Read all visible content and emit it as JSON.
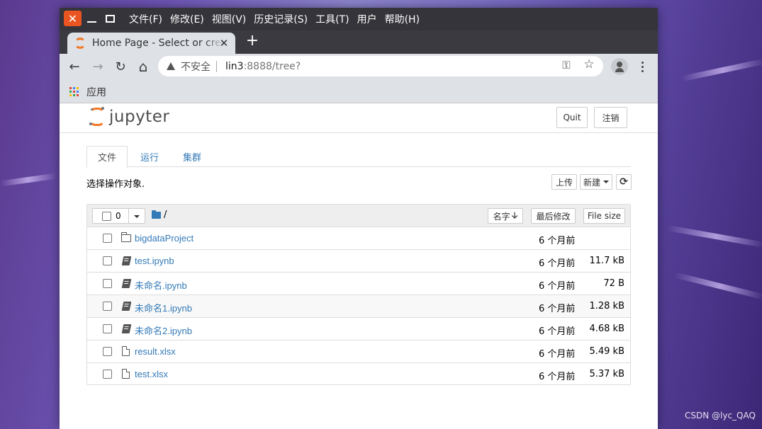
{
  "os": {
    "close_glyph": "✕",
    "watermark": "CSDN @lyc_QAQ"
  },
  "menubar": {
    "items": [
      {
        "label": "文件(F)"
      },
      {
        "label": "修改(E)"
      },
      {
        "label": "视图(V)"
      },
      {
        "label": "历史记录(S)"
      },
      {
        "label": "工具(T)"
      },
      {
        "label": "用户"
      },
      {
        "label": "帮助(H)"
      }
    ]
  },
  "browser": {
    "tab": {
      "title": "Home Page - Select or create a notebook",
      "close": "✕"
    },
    "new_tab": "+",
    "nav": {
      "back": "←",
      "forward": "→",
      "reload": "↻",
      "home": "⌂"
    },
    "omnibox": {
      "security": "不安全",
      "host": "lin3",
      "path": ":8888/tree?",
      "key_icon": "⚿",
      "star_icon": "☆"
    },
    "bookmarks": {
      "apps_label": "应用"
    }
  },
  "jupyter": {
    "logo_text": "jupyter",
    "quit_label": "Quit",
    "logout_label": "注销",
    "tabs": [
      {
        "label": "文件",
        "active": true
      },
      {
        "label": "运行",
        "active": false
      },
      {
        "label": "集群",
        "active": false
      }
    ],
    "select_label": "选择操作对象.",
    "upload_label": "上传",
    "new_label": "新建",
    "refresh_icon": "⟳",
    "list_header": {
      "selected_count": "0",
      "breadcrumb": "/",
      "sort_name": "名字",
      "sort_arrow": "🡣",
      "sort_modified": "最后修改",
      "sort_size": "File size"
    },
    "files": [
      {
        "type": "folder",
        "name": "bigdataProject",
        "modified": "6 个月前",
        "size": ""
      },
      {
        "type": "notebook",
        "name": "test.ipynb",
        "modified": "6 个月前",
        "size": "11.7 kB"
      },
      {
        "type": "notebook",
        "name": "未命名.ipynb",
        "modified": "6 个月前",
        "size": "72 B"
      },
      {
        "type": "notebook",
        "name": "未命名1.ipynb",
        "modified": "6 个月前",
        "size": "1.28 kB"
      },
      {
        "type": "notebook",
        "name": "未命名2.ipynb",
        "modified": "6 个月前",
        "size": "4.68 kB"
      },
      {
        "type": "file",
        "name": "result.xlsx",
        "modified": "6 个月前",
        "size": "5.49 kB"
      },
      {
        "type": "file",
        "name": "test.xlsx",
        "modified": "6 个月前",
        "size": "5.37 kB"
      }
    ]
  },
  "colors": {
    "ubuntu_orange": "#e95420",
    "jupyter_orange": "#f37726",
    "link_blue": "#337ab7"
  }
}
